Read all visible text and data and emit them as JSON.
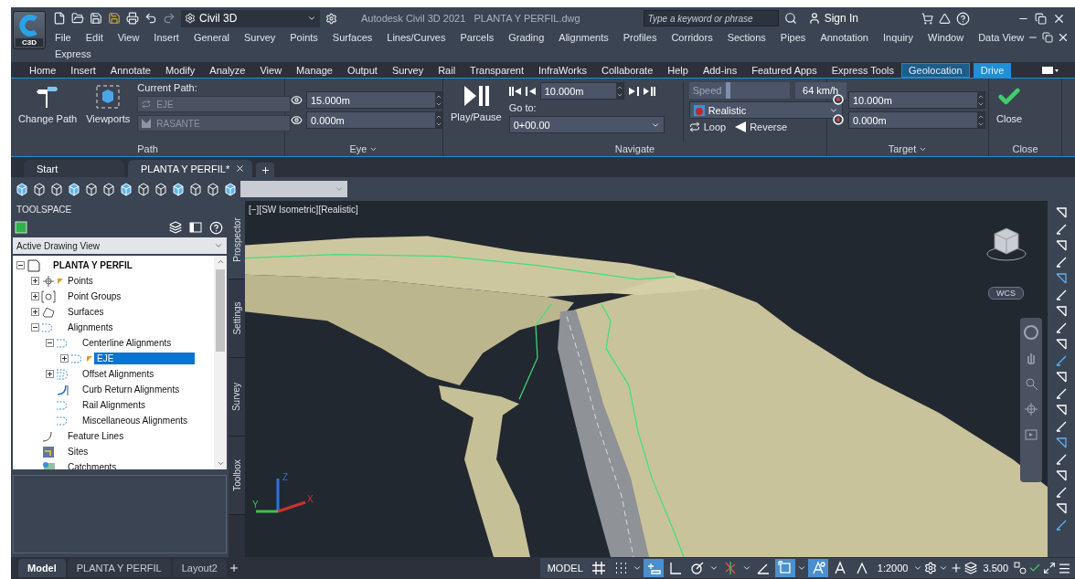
{
  "app": {
    "logo": "C3D",
    "workspace": "Civil 3D",
    "title": "Autodesk Civil 3D 2021   PLANTA Y PERFIL.dwg",
    "search": {
      "placeholder": "Type a keyword or phrase"
    },
    "sign_in": "Sign In"
  },
  "menu_rows": [
    [
      "File",
      "Edit",
      "View",
      "Insert",
      "General",
      "Survey",
      "Points",
      "Surfaces",
      "Lines/Curves",
      "Parcels",
      "Grading",
      "Alignments",
      "Profiles",
      "Corridors",
      "Sections",
      "Pipes",
      "Annotation",
      "Inquiry",
      "Window",
      "Data View"
    ],
    [
      "Express"
    ]
  ],
  "ribbon_tabs": [
    {
      "label": "Home",
      "selected": false,
      "kind": "standard"
    },
    {
      "label": "Insert",
      "selected": false,
      "kind": "standard"
    },
    {
      "label": "Annotate",
      "selected": false,
      "kind": "standard"
    },
    {
      "label": "Modify",
      "selected": false,
      "kind": "standard"
    },
    {
      "label": "Analyze",
      "selected": false,
      "kind": "standard"
    },
    {
      "label": "View",
      "selected": false,
      "kind": "standard"
    },
    {
      "label": "Manage",
      "selected": false,
      "kind": "standard"
    },
    {
      "label": "Output",
      "selected": false,
      "kind": "standard"
    },
    {
      "label": "Survey",
      "selected": false,
      "kind": "standard"
    },
    {
      "label": "Rail",
      "selected": false,
      "kind": "standard"
    },
    {
      "label": "Transparent",
      "selected": false,
      "kind": "standard"
    },
    {
      "label": "InfraWorks",
      "selected": false,
      "kind": "standard"
    },
    {
      "label": "Collaborate",
      "selected": false,
      "kind": "standard"
    },
    {
      "label": "Help",
      "selected": false,
      "kind": "standard"
    },
    {
      "label": "Add-ins",
      "selected": false,
      "kind": "standard"
    },
    {
      "label": "Featured Apps",
      "selected": false,
      "kind": "standard"
    },
    {
      "label": "Express Tools",
      "selected": false,
      "kind": "standard"
    },
    {
      "label": "Geolocation",
      "selected": false,
      "kind": "contextual"
    },
    {
      "label": "Drive",
      "selected": true,
      "kind": "contextual"
    }
  ],
  "ribbon": {
    "path": {
      "title": "Path",
      "change_path": "Change Path",
      "viewports": "Viewports",
      "current_path_label": "Current Path:",
      "alignment": "EJE",
      "profile": "RASANTE"
    },
    "eye": {
      "title": "Eye",
      "height": "15.000m",
      "offset": "0.000m"
    },
    "navigate": {
      "title": "Navigate",
      "play_pause": "Play/Pause",
      "step": "10.000m",
      "go_to_label": "Go to:",
      "go_to": "0+00.00",
      "speed_label": "Speed",
      "speed": {
        "level": 0.41
      },
      "speed_value": "64 km/h",
      "visual_style": "Realistic",
      "loop": "Loop",
      "reverse": "Reverse"
    },
    "target": {
      "title": "Target",
      "distance": "10.000m",
      "offset": "0.000m"
    },
    "close": {
      "title": "Close",
      "button": "Close"
    }
  },
  "file_tabs": [
    {
      "label": "Start",
      "selected": false,
      "closable": false
    },
    {
      "label": "PLANTA Y PERFIL*",
      "selected": true,
      "closable": true
    }
  ],
  "toolspace": {
    "title": "TOOLSPACE",
    "view_select": "Active Drawing View",
    "tree": [
      {
        "label": "PLANTA Y PERFIL",
        "kind": "drawing",
        "expanded": true,
        "selected": false,
        "flag": false,
        "children": [
          {
            "label": "Points",
            "kind": "points",
            "expanded": false,
            "selected": false,
            "flag": true
          },
          {
            "label": "Point Groups",
            "kind": "point-groups",
            "expanded": false,
            "selected": false,
            "flag": false
          },
          {
            "label": "Surfaces",
            "kind": "surfaces",
            "expanded": false,
            "selected": false,
            "flag": false
          },
          {
            "label": "Alignments",
            "kind": "alignment",
            "expanded": true,
            "selected": false,
            "flag": false,
            "children": [
              {
                "label": "Centerline Alignments",
                "kind": "alignment",
                "expanded": true,
                "selected": false,
                "flag": false,
                "children": [
                  {
                    "label": "EJE",
                    "kind": "alignment",
                    "expanded": false,
                    "selected": true,
                    "flag": true
                  }
                ]
              },
              {
                "label": "Offset Alignments",
                "kind": "offset",
                "expanded": false,
                "selected": false,
                "flag": false
              },
              {
                "label": "Curb Return Alignments",
                "kind": "curb",
                "selected": false,
                "flag": false
              },
              {
                "label": "Rail Alignments",
                "kind": "alignment",
                "selected": false,
                "flag": false
              },
              {
                "label": "Miscellaneous Alignments",
                "kind": "alignment",
                "selected": false,
                "flag": false
              }
            ]
          },
          {
            "label": "Feature Lines",
            "kind": "feature-lines",
            "selected": false,
            "flag": false
          },
          {
            "label": "Sites",
            "kind": "sites",
            "selected": false,
            "flag": false
          },
          {
            "label": "Catchments",
            "kind": "catchments",
            "selected": false,
            "flag": false
          }
        ]
      }
    ],
    "side_tabs": [
      {
        "label": "Prospector",
        "selected": true
      },
      {
        "label": "Settings",
        "selected": false
      },
      {
        "label": "Survey",
        "selected": false
      },
      {
        "label": "Toolbox",
        "selected": false
      }
    ]
  },
  "viewport": {
    "label": "[−][SW Isometric][Realistic]",
    "wcs": "WCS",
    "axes": {
      "x": "X",
      "y": "Y",
      "z": "Z"
    }
  },
  "layout_tabs": [
    {
      "label": "Model",
      "selected": true
    },
    {
      "label": "PLANTA Y PERFIL",
      "selected": false
    },
    {
      "label": "Layout2",
      "selected": false
    }
  ],
  "status_bar": {
    "mode": "MODEL",
    "scale": "1:2000",
    "lineweight": "3.500",
    "toggles": [
      {
        "kind": "grid",
        "on": false
      },
      {
        "kind": "snap",
        "on": false
      },
      {
        "kind": "infer",
        "on": true
      },
      {
        "kind": "ortho",
        "on": false
      },
      {
        "kind": "polar",
        "on": false
      },
      {
        "kind": "isodraft",
        "on": false
      },
      {
        "kind": "angle",
        "on": false
      },
      {
        "kind": "osnap",
        "on": true
      },
      {
        "kind": "annotation",
        "on": true
      },
      {
        "kind": "autoscale",
        "on": false
      },
      {
        "kind": "visibility",
        "on": false
      }
    ]
  }
}
